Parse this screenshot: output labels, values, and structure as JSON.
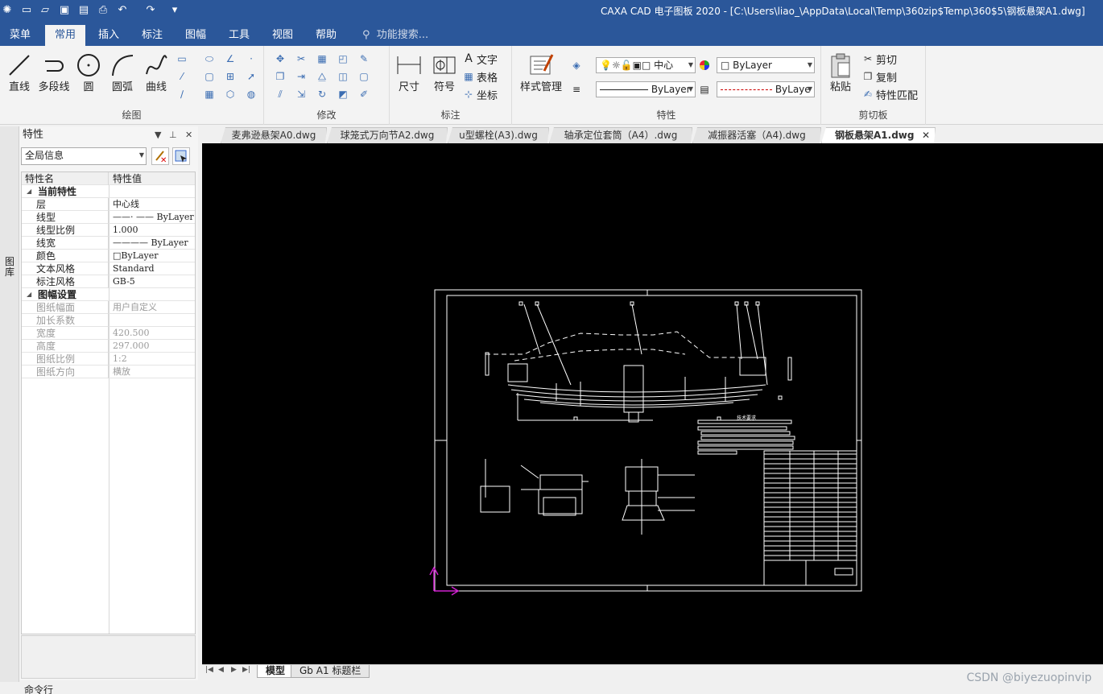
{
  "app": {
    "title": "CAXA CAD 电子图板 2020 - [C:\\Users\\liao_\\AppData\\Local\\Temp\\360zip$Temp\\360$5\\钢板悬架A1.dwg]",
    "menu_tabs": [
      "菜单",
      "常用",
      "插入",
      "标注",
      "图幅",
      "工具",
      "视图",
      "帮助"
    ],
    "active_tab": "常用",
    "search_placeholder": "功能搜索..."
  },
  "ribbon": {
    "draw": {
      "line": "直线",
      "polyline": "多段线",
      "circle": "圆",
      "arc": "圆弧",
      "spline": "曲线",
      "group": "绘图"
    },
    "modify": {
      "group": "修改"
    },
    "annotate": {
      "dimension": "尺寸",
      "symbol": "符号",
      "text": "文字",
      "table": "表格",
      "coord": "坐标",
      "group": "标注"
    },
    "props": {
      "style_mgr": "样式管理",
      "layer": "中心",
      "color": "ByLayer",
      "linetype": "ByLayer",
      "lineweight": "ByLaye",
      "group": "特性"
    },
    "clipboard": {
      "paste": "粘贴",
      "cut": "剪切",
      "copy": "复制",
      "match": "特性匹配",
      "group": "剪切板"
    }
  },
  "side_strip": "图库",
  "panel": {
    "title": "特性",
    "scope": "全局信息",
    "col_name": "特性名",
    "col_value": "特性值",
    "sections": [
      {
        "title": "当前特性",
        "rows": [
          {
            "k": "层",
            "v": "中心线",
            "dim": false
          },
          {
            "k": "线型",
            "v": "——· —— ByLayer",
            "dim": false
          },
          {
            "k": "线型比例",
            "v": "1.000",
            "dim": false
          },
          {
            "k": "线宽",
            "v": "———— ByLayer",
            "dim": false
          },
          {
            "k": "颜色",
            "v": "□ByLayer",
            "dim": false
          },
          {
            "k": "文本风格",
            "v": "Standard",
            "dim": false
          },
          {
            "k": "标注风格",
            "v": "GB-5",
            "dim": false
          }
        ]
      },
      {
        "title": "图幅设置",
        "rows": [
          {
            "k": "图纸幅面",
            "v": "用户自定义",
            "dim": true
          },
          {
            "k": "加长系数",
            "v": "",
            "dim": true
          },
          {
            "k": "宽度",
            "v": "420.500",
            "dim": true
          },
          {
            "k": "高度",
            "v": "297.000",
            "dim": true
          },
          {
            "k": "图纸比例",
            "v": "1:2",
            "dim": true
          },
          {
            "k": "图纸方向",
            "v": "横放",
            "dim": true
          }
        ]
      }
    ]
  },
  "doc_tabs": [
    "麦弗逊悬架A0.dwg",
    "球笼式万向节A2.dwg",
    "u型螺栓(A3).dwg",
    "轴承定位套筒（A4）.dwg",
    "减振器活塞（A4).dwg",
    "钢板悬架A1.dwg"
  ],
  "active_doc": "钢板悬架A1.dwg",
  "drawing": {
    "tech_req_title": "技术要求"
  },
  "sheet_tabs": [
    "模型",
    "Gb A1 标题栏"
  ],
  "command_line": "命令行",
  "watermark": "CSDN @biyezuopinvip",
  "colors": {
    "titlebar": "#2b579a",
    "canvas": "#000000",
    "ucs": "#d020d0"
  }
}
